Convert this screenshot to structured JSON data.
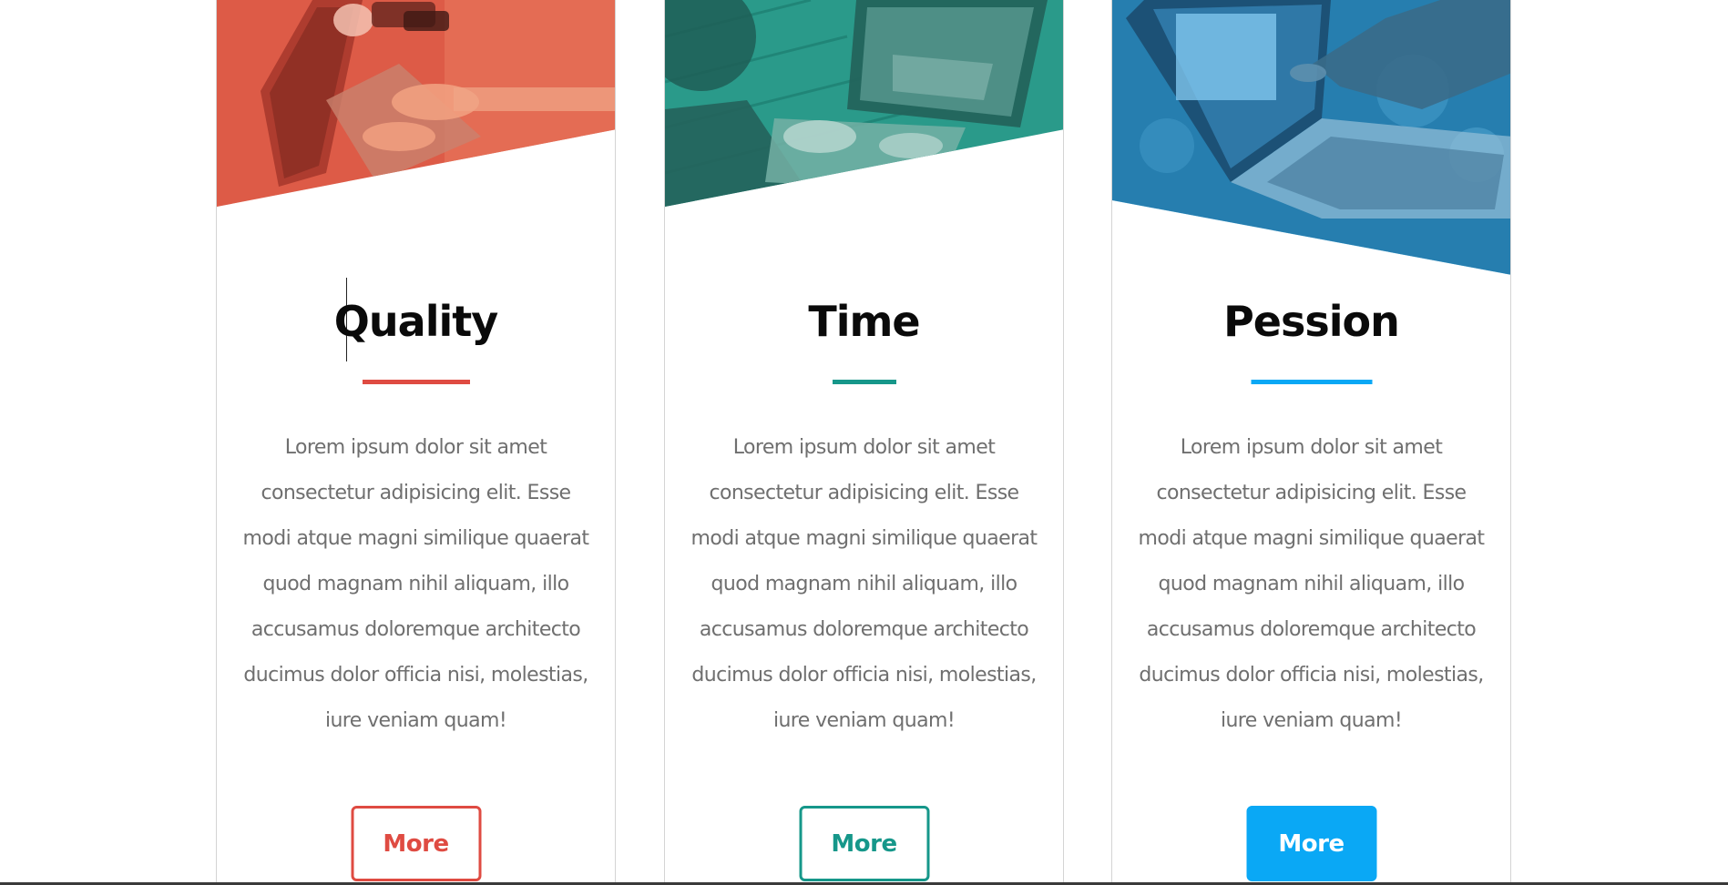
{
  "cards": [
    {
      "title": "Quality",
      "text": "Lorem ipsum dolor sit amet consectetur adipisicing elit. Esse modi atque magni similique quaerat quod magnam nihil aliquam, illo accusamus doloremque architecto ducimus dolor officia nisi, molestias, iure veniam quam!",
      "button_label": "More",
      "accent_color": "#df4b42",
      "button_style": "outline",
      "image": "laptop-typing-photo"
    },
    {
      "title": "Time",
      "text": "Lorem ipsum dolor sit amet consectetur adipisicing elit. Esse modi atque magni similique quaerat quod magnam nihil aliquam, illo accusamus doloremque architecto ducimus dolor officia nisi, molestias, iure veniam quam!",
      "button_label": "More",
      "accent_color": "#16978a",
      "button_style": "outline",
      "image": "laptop-outdoor-photo"
    },
    {
      "title": "Pession",
      "text": "Lorem ipsum dolor sit amet consectetur adipisicing elit. Esse modi atque magni similique quaerat quod magnam nihil aliquam, illo accusamus doloremque architecto ducimus dolor officia nisi, molestias, iure veniam quam!",
      "button_label": "More",
      "accent_color": "#0aa8f5",
      "button_style": "solid",
      "image": "laptop-pointing-photo"
    }
  ]
}
